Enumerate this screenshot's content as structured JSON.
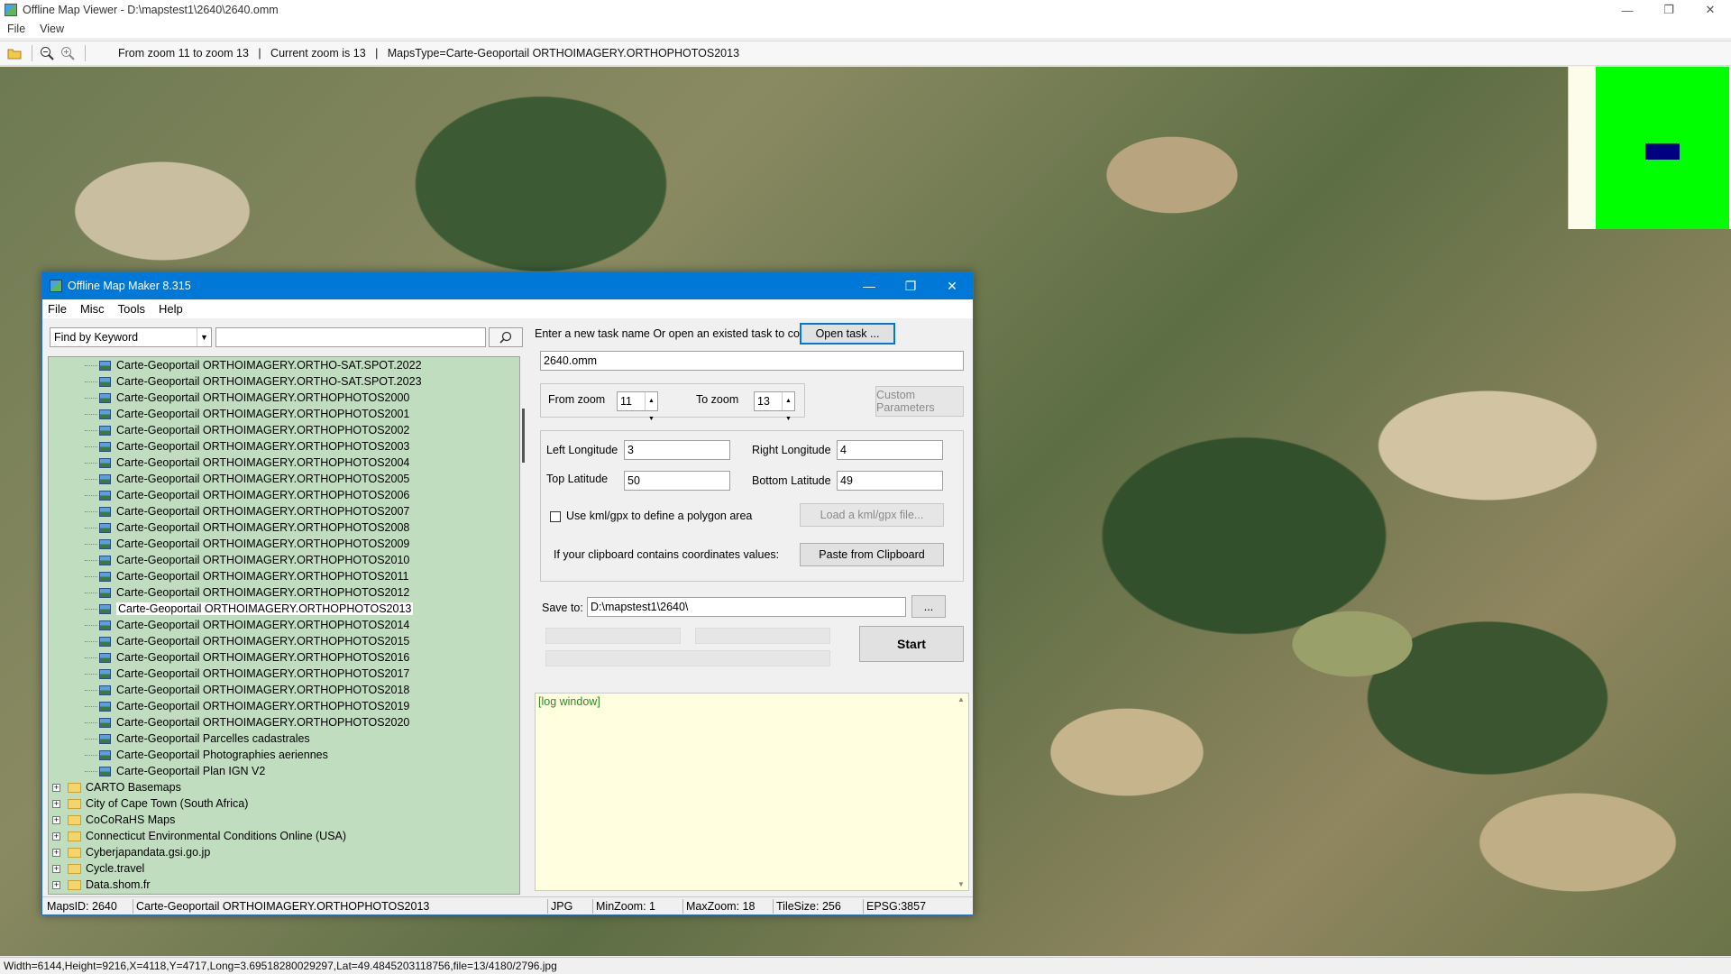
{
  "window": {
    "title": "Offline Map Viewer - D:\\mapstest1\\2640\\2640.omm",
    "controls": [
      "—",
      "❐",
      "✕"
    ]
  },
  "menu": [
    "File",
    "View"
  ],
  "toolbar": {
    "icons": [
      "open-folder-icon",
      "zoom-out-icon",
      "zoom-in-icon"
    ],
    "status": "From zoom 11 to zoom 13   |   Current zoom is 13   |   MapsType=Carte-Geoportail ORTHOIMAGERY.ORTHOPHOTOS2013"
  },
  "colors": {
    "minimap_bg": "#fdfbea",
    "minimap_area": "#00ff00",
    "minimap_view": "#000080",
    "dialog_titlebar": "#0078d7",
    "tree_bg": "#c0ddc0",
    "log_bg": "#ffffe0",
    "log_text": "#2a8a2a"
  },
  "bottom_status": "Width=6144,Height=9216,X=4118,Y=4717,Long=3.69518280029297,Lat=49.4845203118756,file=13/4180/2796.jpg",
  "dialog": {
    "title": "Offline Map Maker 8.315",
    "menu": [
      "File",
      "Misc",
      "Tools",
      "Help"
    ],
    "search": {
      "mode": "Find by Keyword",
      "query": ""
    },
    "tree": {
      "items": [
        "Carte-Geoportail ORTHOIMAGERY.ORTHO-SAT.SPOT.2022",
        "Carte-Geoportail ORTHOIMAGERY.ORTHO-SAT.SPOT.2023",
        "Carte-Geoportail ORTHOIMAGERY.ORTHOPHOTOS2000",
        "Carte-Geoportail ORTHOIMAGERY.ORTHOPHOTOS2001",
        "Carte-Geoportail ORTHOIMAGERY.ORTHOPHOTOS2002",
        "Carte-Geoportail ORTHOIMAGERY.ORTHOPHOTOS2003",
        "Carte-Geoportail ORTHOIMAGERY.ORTHOPHOTOS2004",
        "Carte-Geoportail ORTHOIMAGERY.ORTHOPHOTOS2005",
        "Carte-Geoportail ORTHOIMAGERY.ORTHOPHOTOS2006",
        "Carte-Geoportail ORTHOIMAGERY.ORTHOPHOTOS2007",
        "Carte-Geoportail ORTHOIMAGERY.ORTHOPHOTOS2008",
        "Carte-Geoportail ORTHOIMAGERY.ORTHOPHOTOS2009",
        "Carte-Geoportail ORTHOIMAGERY.ORTHOPHOTOS2010",
        "Carte-Geoportail ORTHOIMAGERY.ORTHOPHOTOS2011",
        "Carte-Geoportail ORTHOIMAGERY.ORTHOPHOTOS2012",
        "Carte-Geoportail ORTHOIMAGERY.ORTHOPHOTOS2013",
        "Carte-Geoportail ORTHOIMAGERY.ORTHOPHOTOS2014",
        "Carte-Geoportail ORTHOIMAGERY.ORTHOPHOTOS2015",
        "Carte-Geoportail ORTHOIMAGERY.ORTHOPHOTOS2016",
        "Carte-Geoportail ORTHOIMAGERY.ORTHOPHOTOS2017",
        "Carte-Geoportail ORTHOIMAGERY.ORTHOPHOTOS2018",
        "Carte-Geoportail ORTHOIMAGERY.ORTHOPHOTOS2019",
        "Carte-Geoportail ORTHOIMAGERY.ORTHOPHOTOS2020",
        "Carte-Geoportail Parcelles cadastrales",
        "Carte-Geoportail Photographies aeriennes",
        "Carte-Geoportail Plan IGN V2"
      ],
      "selected": "Carte-Geoportail ORTHOIMAGERY.ORTHOPHOTOS2013",
      "folders": [
        "CARTO Basemaps",
        "City of Cape Town (South Africa)",
        "CoCoRaHS Maps",
        "Connecticut Environmental Conditions Online (USA)",
        "Cyberjapandata.gsi.go.jp",
        "Cycle.travel",
        "Data.shom.fr"
      ]
    },
    "task": {
      "prompt": "Enter a new task name Or open an existed task to continue:",
      "open_button": "Open task ...",
      "name": "2640.omm"
    },
    "zoom": {
      "from_label": "From zoom",
      "from_value": "11",
      "to_label": "To zoom",
      "to_value": "13",
      "custom_button": "Custom Parameters"
    },
    "area": {
      "left_lon_label": "Left Longitude",
      "left_lon": "3",
      "right_lon_label": "Right Longitude",
      "right_lon": "4",
      "top_lat_label": "Top Latitude",
      "top_lat": "50",
      "bottom_lat_label": "Bottom Latitude",
      "bottom_lat": "49",
      "kml_label": "Use kml/gpx to define a polygon area",
      "kml_button": "Load a kml/gpx file...",
      "clipboard_label": "If your clipboard contains coordinates values:",
      "clipboard_button": "Paste from Clipboard"
    },
    "save": {
      "label": "Save to:",
      "path": "D:\\mapstest1\\2640\\",
      "browse": "..."
    },
    "start_button": "Start",
    "log": "[log window]",
    "status": {
      "maps_id": "MapsID: 2640",
      "map_name": "Carte-Geoportail ORTHOIMAGERY.ORTHOPHOTOS2013",
      "format": "JPG",
      "min_zoom": "MinZoom: 1",
      "max_zoom": "MaxZoom: 18",
      "tile_size": "TileSize: 256",
      "epsg": "EPSG:3857"
    }
  }
}
